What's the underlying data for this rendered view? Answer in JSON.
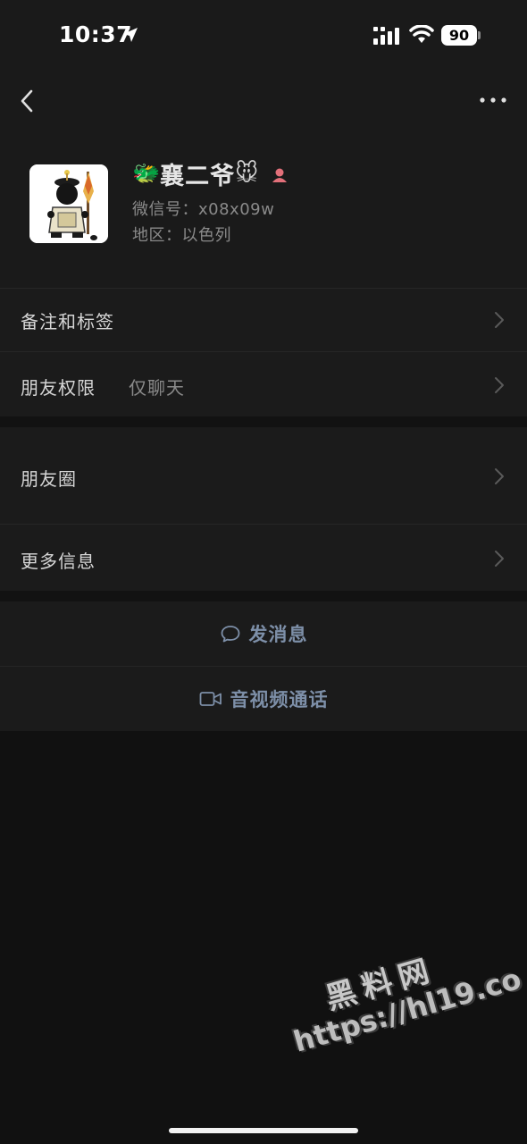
{
  "status_bar": {
    "time": "10:37",
    "battery": "90",
    "icons": [
      "location-arrow-icon",
      "cellular-signal-icon",
      "wifi-icon",
      "battery-icon"
    ]
  },
  "nav": {
    "back_icon": "chevron-left-icon",
    "more_icon": "more-dots-icon"
  },
  "profile": {
    "name": "襄二爷",
    "name_prefix_emoji": "🐲",
    "name_suffix_emoji": "🐭",
    "gender_icon": "female-gender-icon",
    "wechat_id": "微信号：x08x09w",
    "region": "地区：以色列"
  },
  "rows": [
    {
      "label": "备注和标签",
      "value": ""
    },
    {
      "label": "朋友权限",
      "value": "仅聊天"
    },
    {
      "label": "朋友圈",
      "value": ""
    },
    {
      "label": "更多信息",
      "value": ""
    }
  ],
  "actions": [
    {
      "label": "发消息",
      "icon": "chat-bubble-icon"
    },
    {
      "label": "音视频通话",
      "icon": "video-camera-icon"
    }
  ],
  "watermark": {
    "title": "黑料网",
    "url": "https://hl19.co"
  },
  "colors": {
    "background": "#111111",
    "surface": "#1b1b1b",
    "action_text": "#7d8fa8",
    "secondary_text": "#8a8a8a"
  }
}
